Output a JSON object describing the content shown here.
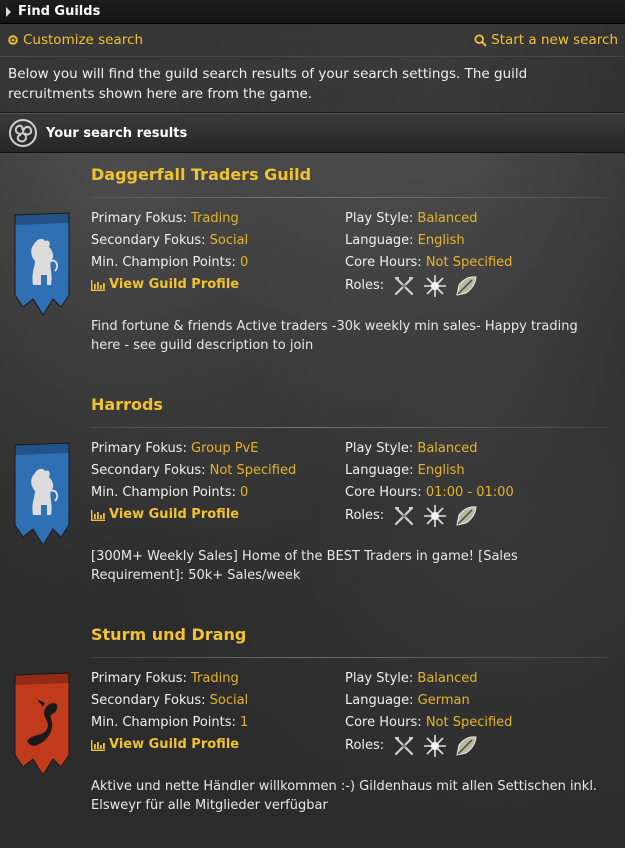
{
  "window": {
    "title": "Find Guilds"
  },
  "toolbar": {
    "customize_label": "Customize search",
    "new_search_label": "Start a new search"
  },
  "intro": "Below you will find the guild search results of your search settings. The guild recruitments shown here are from the game.",
  "results_header": "Your search results",
  "labels": {
    "primary": "Primary Fokus: ",
    "secondary": "Secondary Fokus: ",
    "champion": "Min. Champion Points: ",
    "playstyle": "Play Style: ",
    "language": "Language: ",
    "core_hours": "Core Hours: ",
    "roles": "Roles:",
    "view_profile": "View Guild Profile"
  },
  "guilds": [
    {
      "name": "Daggerfall Traders Guild",
      "banner_color": "#2f6fb3",
      "emblem": "lion",
      "primary": "Trading",
      "secondary": "Social",
      "champion": "0",
      "playstyle": "Balanced",
      "language": "English",
      "core_hours": "Not Specified",
      "description": "Find fortune & friends Active traders -30k weekly min sales- Happy trading here - see guild description to join"
    },
    {
      "name": "Harrods",
      "banner_color": "#2f6fb3",
      "emblem": "lion",
      "primary": "Group PvE",
      "secondary": "Not Specified",
      "champion": "0",
      "playstyle": "Balanced",
      "language": "English",
      "core_hours": "01:00 - 01:00",
      "description": "[300M+ Weekly Sales] Home of the BEST Traders in game! [Sales Requirement]: 50k+ Sales/week"
    },
    {
      "name": "Sturm und Drang",
      "banner_color": "#c23a1c",
      "emblem": "dragon",
      "primary": "Trading",
      "secondary": "Social",
      "champion": "1",
      "playstyle": "Balanced",
      "language": "German",
      "core_hours": "Not Specified",
      "description": "Aktive und nette Händler willkommen :-) Gildenhaus mit allen Settischen inkl. Elsweyr für alle Mitglieder verfügbar"
    }
  ],
  "colors": {
    "accent": "#f2c230",
    "value": "#e6b42c"
  },
  "icons": [
    "gear-icon",
    "search-icon",
    "triskelion-icon",
    "bar-chart-icon",
    "tank-role-icon",
    "healer-role-icon",
    "dps-role-icon"
  ]
}
